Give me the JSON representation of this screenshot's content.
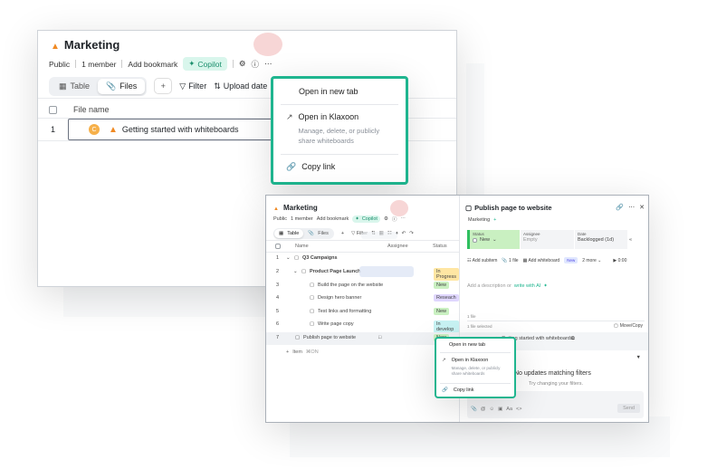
{
  "window1": {
    "title": "Marketing",
    "meta": {
      "visibility": "Public",
      "members": "1 member",
      "bookmark": "Add bookmark",
      "copilot": "Copilot"
    },
    "toolbar": {
      "tab_table": "Table",
      "tab_files": "Files",
      "filter": "Filter",
      "sort": "Upload date"
    },
    "table": {
      "col_file_name": "File name",
      "rows": [
        {
          "index": "1",
          "name": "Getting started with whiteboards"
        }
      ]
    }
  },
  "menu1": {
    "open_new_tab": "Open in new tab",
    "open_klaxoon": "Open in Klaxoon",
    "open_klaxoon_desc": "Manage, delete, or publicly share whiteboards",
    "copy_link": "Copy link"
  },
  "window2": {
    "title": "Marketing",
    "meta": {
      "visibility": "Public",
      "members": "1 member",
      "bookmark": "Add bookmark",
      "copilot": "Copilot"
    },
    "toolbar": {
      "tab_table": "Table",
      "tab_files": "Files",
      "filter": "Filter"
    },
    "columns": {
      "name": "Name",
      "assignee": "Assignee",
      "status": "Status"
    },
    "rows": [
      {
        "index": "1",
        "name": "Q3 Campaigns",
        "status": ""
      },
      {
        "index": "2",
        "name": "Product Page Launch",
        "status": "In Progress"
      },
      {
        "index": "3",
        "name": "Build the page on the website",
        "status": "New"
      },
      {
        "index": "4",
        "name": "Design hero banner",
        "status": "Reseach"
      },
      {
        "index": "5",
        "name": "Test links and formatting",
        "status": "New"
      },
      {
        "index": "6",
        "name": "Write page copy",
        "status": "In develop"
      },
      {
        "index": "7",
        "name": "Publish page to website",
        "status": "New"
      }
    ],
    "add_item": "Item",
    "add_item_hint": "⌘ON",
    "panel": {
      "title": "Publish page to website",
      "breadcrumb": "Marketing",
      "status_label": "Status",
      "status_value": "New",
      "assignee_label": "Assignee",
      "assignee_value": "Empty",
      "date_label": "Date",
      "date_value": "Backlogged (1d)",
      "add_subitem": "Add subitem",
      "files": "1 file",
      "add_whiteboard": "Add whiteboard",
      "new_badge": "New",
      "more": "2 more",
      "timer": "0:00",
      "description_placeholder": "Add a description or",
      "write_ai": "write with AI",
      "files_count": "1 file",
      "file_selected": "1 file selected",
      "move_copy": "Move/Copy",
      "file_name": "Getting started with whiteboards",
      "no_updates": "No updates matching filters",
      "try_changing": "Try changing your filters.",
      "send": "Send"
    }
  },
  "menu2": {
    "open_new_tab": "Open in new tab",
    "open_klaxoon": "Open in Klaxoon",
    "open_klaxoon_desc": "Manage, delete, or publicly share whiteboards",
    "copy_link": "Copy link"
  },
  "colors": {
    "accent": "#1fb58f",
    "copilot_bg": "#d9f6ec",
    "status_new": "#7fd67f",
    "status_progress": "#ffd86b",
    "status_research": "#b9a6ff",
    "status_develop": "#8ee3e8"
  }
}
